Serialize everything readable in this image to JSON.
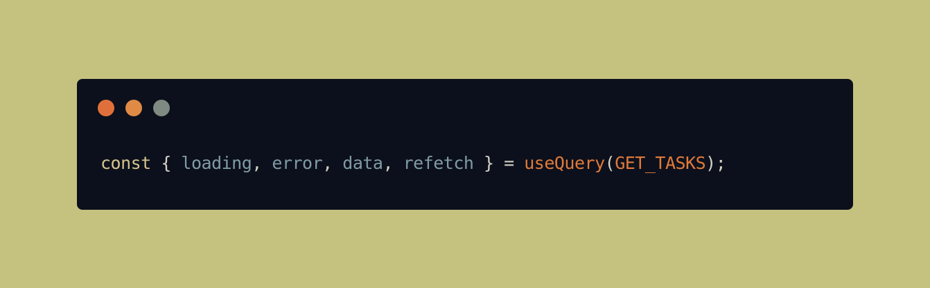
{
  "window": {
    "controls": [
      {
        "name": "close",
        "color": "#e0703b"
      },
      {
        "name": "minimize",
        "color": "#e08a45"
      },
      {
        "name": "maximize",
        "color": "#7f8a82"
      }
    ]
  },
  "code": {
    "line": [
      {
        "text": "const",
        "color": "#d4c48d"
      },
      {
        "text": " { ",
        "color": "#d5d2c5"
      },
      {
        "text": "loading",
        "color": "#7f9ba3"
      },
      {
        "text": ", ",
        "color": "#d5d2c5"
      },
      {
        "text": "error",
        "color": "#7f9ba3"
      },
      {
        "text": ", ",
        "color": "#d5d2c5"
      },
      {
        "text": "data",
        "color": "#7f9ba3"
      },
      {
        "text": ", ",
        "color": "#d5d2c5"
      },
      {
        "text": "refetch",
        "color": "#7f9ba3"
      },
      {
        "text": " } = ",
        "color": "#d5d2c5"
      },
      {
        "text": "useQuery",
        "color": "#e07a3a"
      },
      {
        "text": "(",
        "color": "#d5d2c5"
      },
      {
        "text": "GET_TASKS",
        "color": "#e07a3a"
      },
      {
        "text": ");",
        "color": "#d5d2c5"
      }
    ]
  }
}
